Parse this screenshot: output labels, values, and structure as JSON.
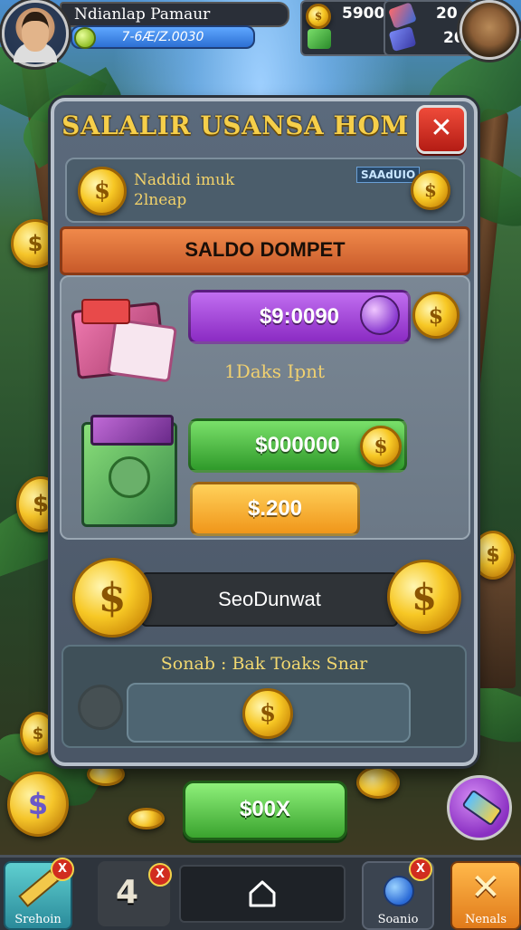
{
  "player": {
    "name": "Ndianlap Pamaur",
    "xp_text": "7-6Æ/Z.0030"
  },
  "resources": {
    "coins": "5900",
    "gems": "20",
    "cards": "20"
  },
  "panel": {
    "title": "SALALIR USANSA HOM",
    "close_label": "✕",
    "info_label_line1": "Naddid imuk",
    "info_label_line2": "2lneap",
    "info_badge": "SAAdUIO",
    "banner": "SALDO DOMPET",
    "purple_value": "$9:0090",
    "mid_label": "1Daks Ipnt",
    "green_value": "$000000",
    "orange_value": "$.200",
    "balance_label": "SeoDunwat",
    "lower_title": "Sonab : Bak Toaks Snar"
  },
  "claim_button": "$00X",
  "nav": {
    "left_label": "Srehoin",
    "left_badge": "X",
    "tile_number": "4",
    "tile_badge": "X",
    "home_icon": "home-icon",
    "right_label": "Soanio",
    "right_badge": "X",
    "far_right_label": "Nenals",
    "far_right_icon": "✕"
  },
  "colors": {
    "accent_gold": "#f6cf4a",
    "purple": "#8b2bc3",
    "green": "#2f9a2a",
    "orange": "#f0961a",
    "close_red": "#b41c14"
  }
}
